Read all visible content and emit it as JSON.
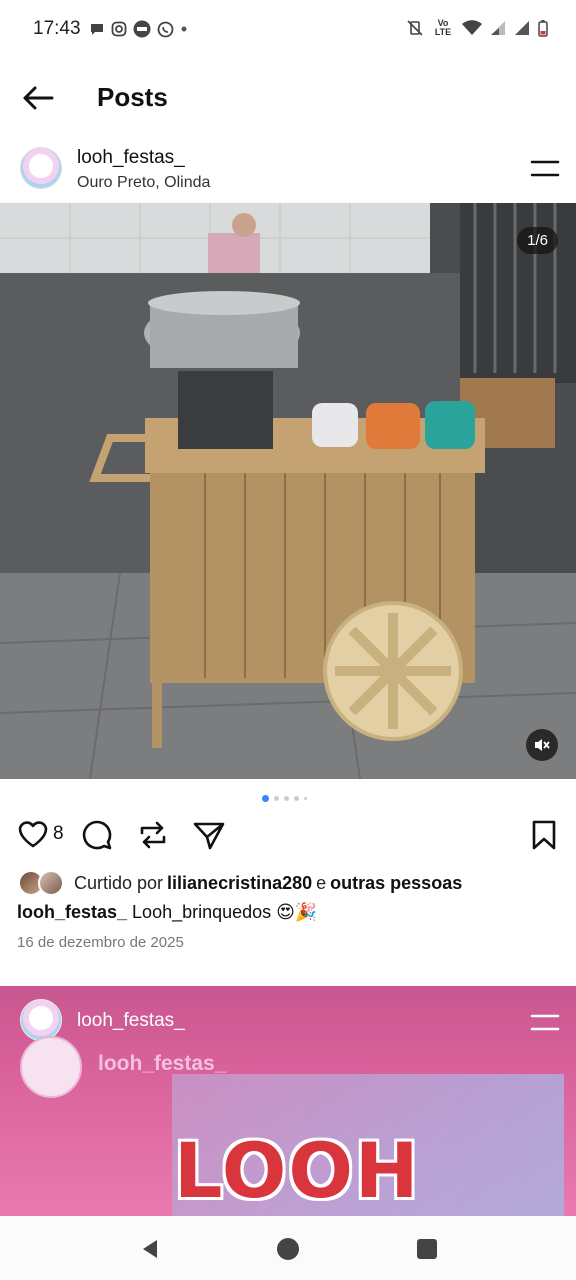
{
  "status_bar": {
    "time": "17:43",
    "lte_label": "Vo LTE"
  },
  "header": {
    "title": "Posts"
  },
  "post": {
    "username": "looh_festas_",
    "location": "Ouro Preto, Olinda",
    "image_counter": "1/6",
    "like_count": "8",
    "liked_by_prefix": "Curtido por",
    "liked_by_user": "lilianecristina280",
    "liked_by_connector": "e",
    "liked_by_suffix": "outras pessoas",
    "caption_user": "looh_festas_",
    "caption_text": "Looh_brinquedos 😍🎉",
    "date": "16 de dezembro de 2025",
    "carousel_total": 6,
    "carousel_current": 1
  },
  "post2": {
    "username": "looh_festas_",
    "inner_username": "looh_festas_",
    "brand_text": "LOOH"
  },
  "colors": {
    "accent_dot": "#3b82f6",
    "post2_bg": "#d9619b",
    "brand_red": "#d8353c"
  },
  "icons": {
    "back": "arrow-left-icon",
    "menu": "hamburger-icon",
    "like": "heart-icon",
    "comment": "comment-icon",
    "repost": "repost-icon",
    "share": "send-icon",
    "save": "bookmark-icon",
    "mute": "speaker-muted-icon"
  }
}
